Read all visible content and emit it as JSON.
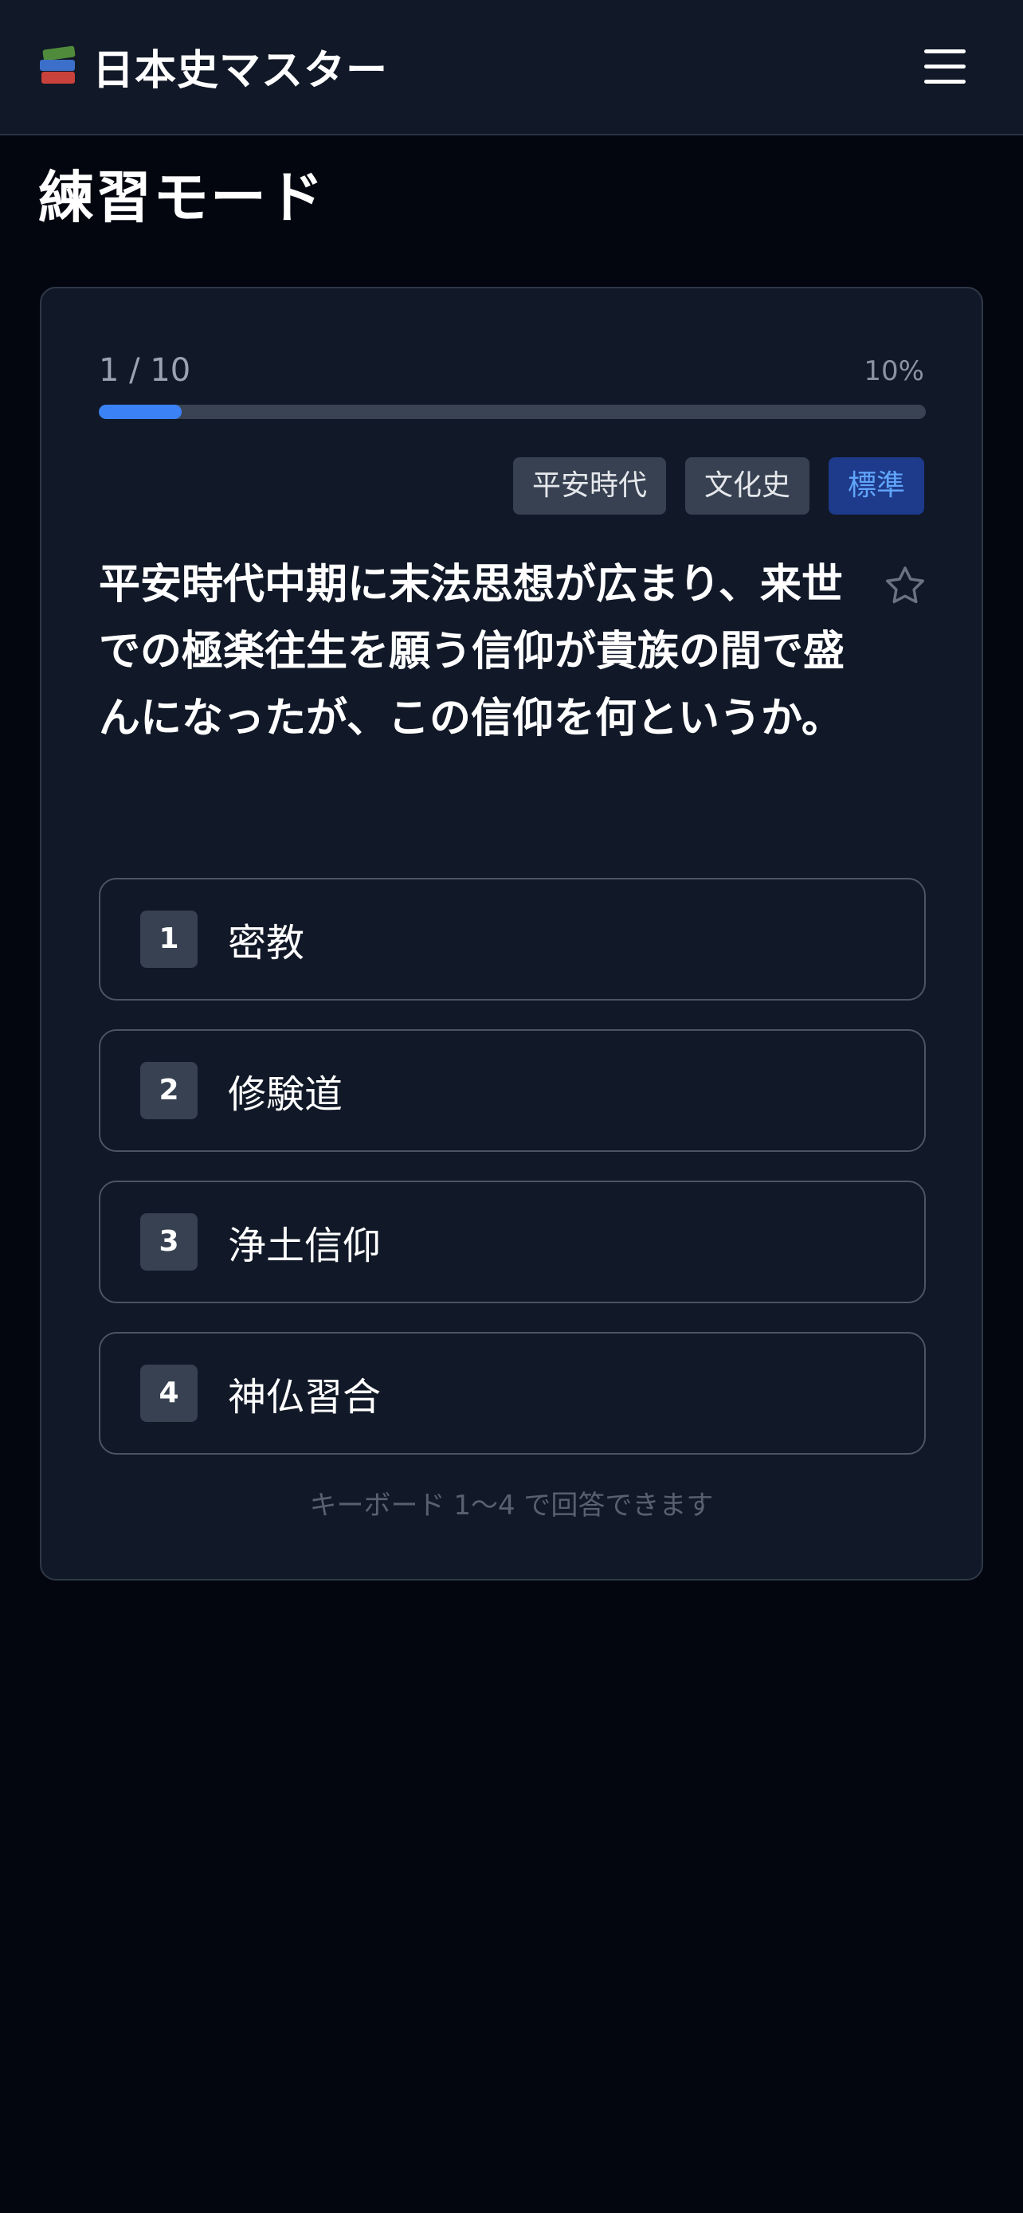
{
  "app": {
    "title": "日本史マスター"
  },
  "page": {
    "title": "練習モード"
  },
  "progress": {
    "count_label": "1 / 10",
    "percent_label": "10%",
    "fraction": 0.1
  },
  "tags": [
    {
      "label": "平安時代"
    },
    {
      "label": "文化史"
    },
    {
      "label": "標準"
    }
  ],
  "question": {
    "text": "平安時代中期に末法思想が広まり、来世での極楽往生を願う信仰が貴族の間で盛んになったが、この信仰を何というか。"
  },
  "options": [
    {
      "number": "1",
      "label": "密教"
    },
    {
      "number": "2",
      "label": "修験道"
    },
    {
      "number": "3",
      "label": "浄土信仰"
    },
    {
      "number": "4",
      "label": "神仏習合"
    }
  ],
  "hint": {
    "text": "キーボード 1〜4 で回答できます"
  },
  "colors": {
    "accent": "#3b82f6",
    "background": "#03060f",
    "card": "#111827",
    "level_tag_bg": "#1e3a8a",
    "level_tag_text": "#60a5fa"
  },
  "icons": {
    "brand": "books-icon",
    "menu": "hamburger-menu-icon",
    "favorite": "star-outline-icon"
  }
}
